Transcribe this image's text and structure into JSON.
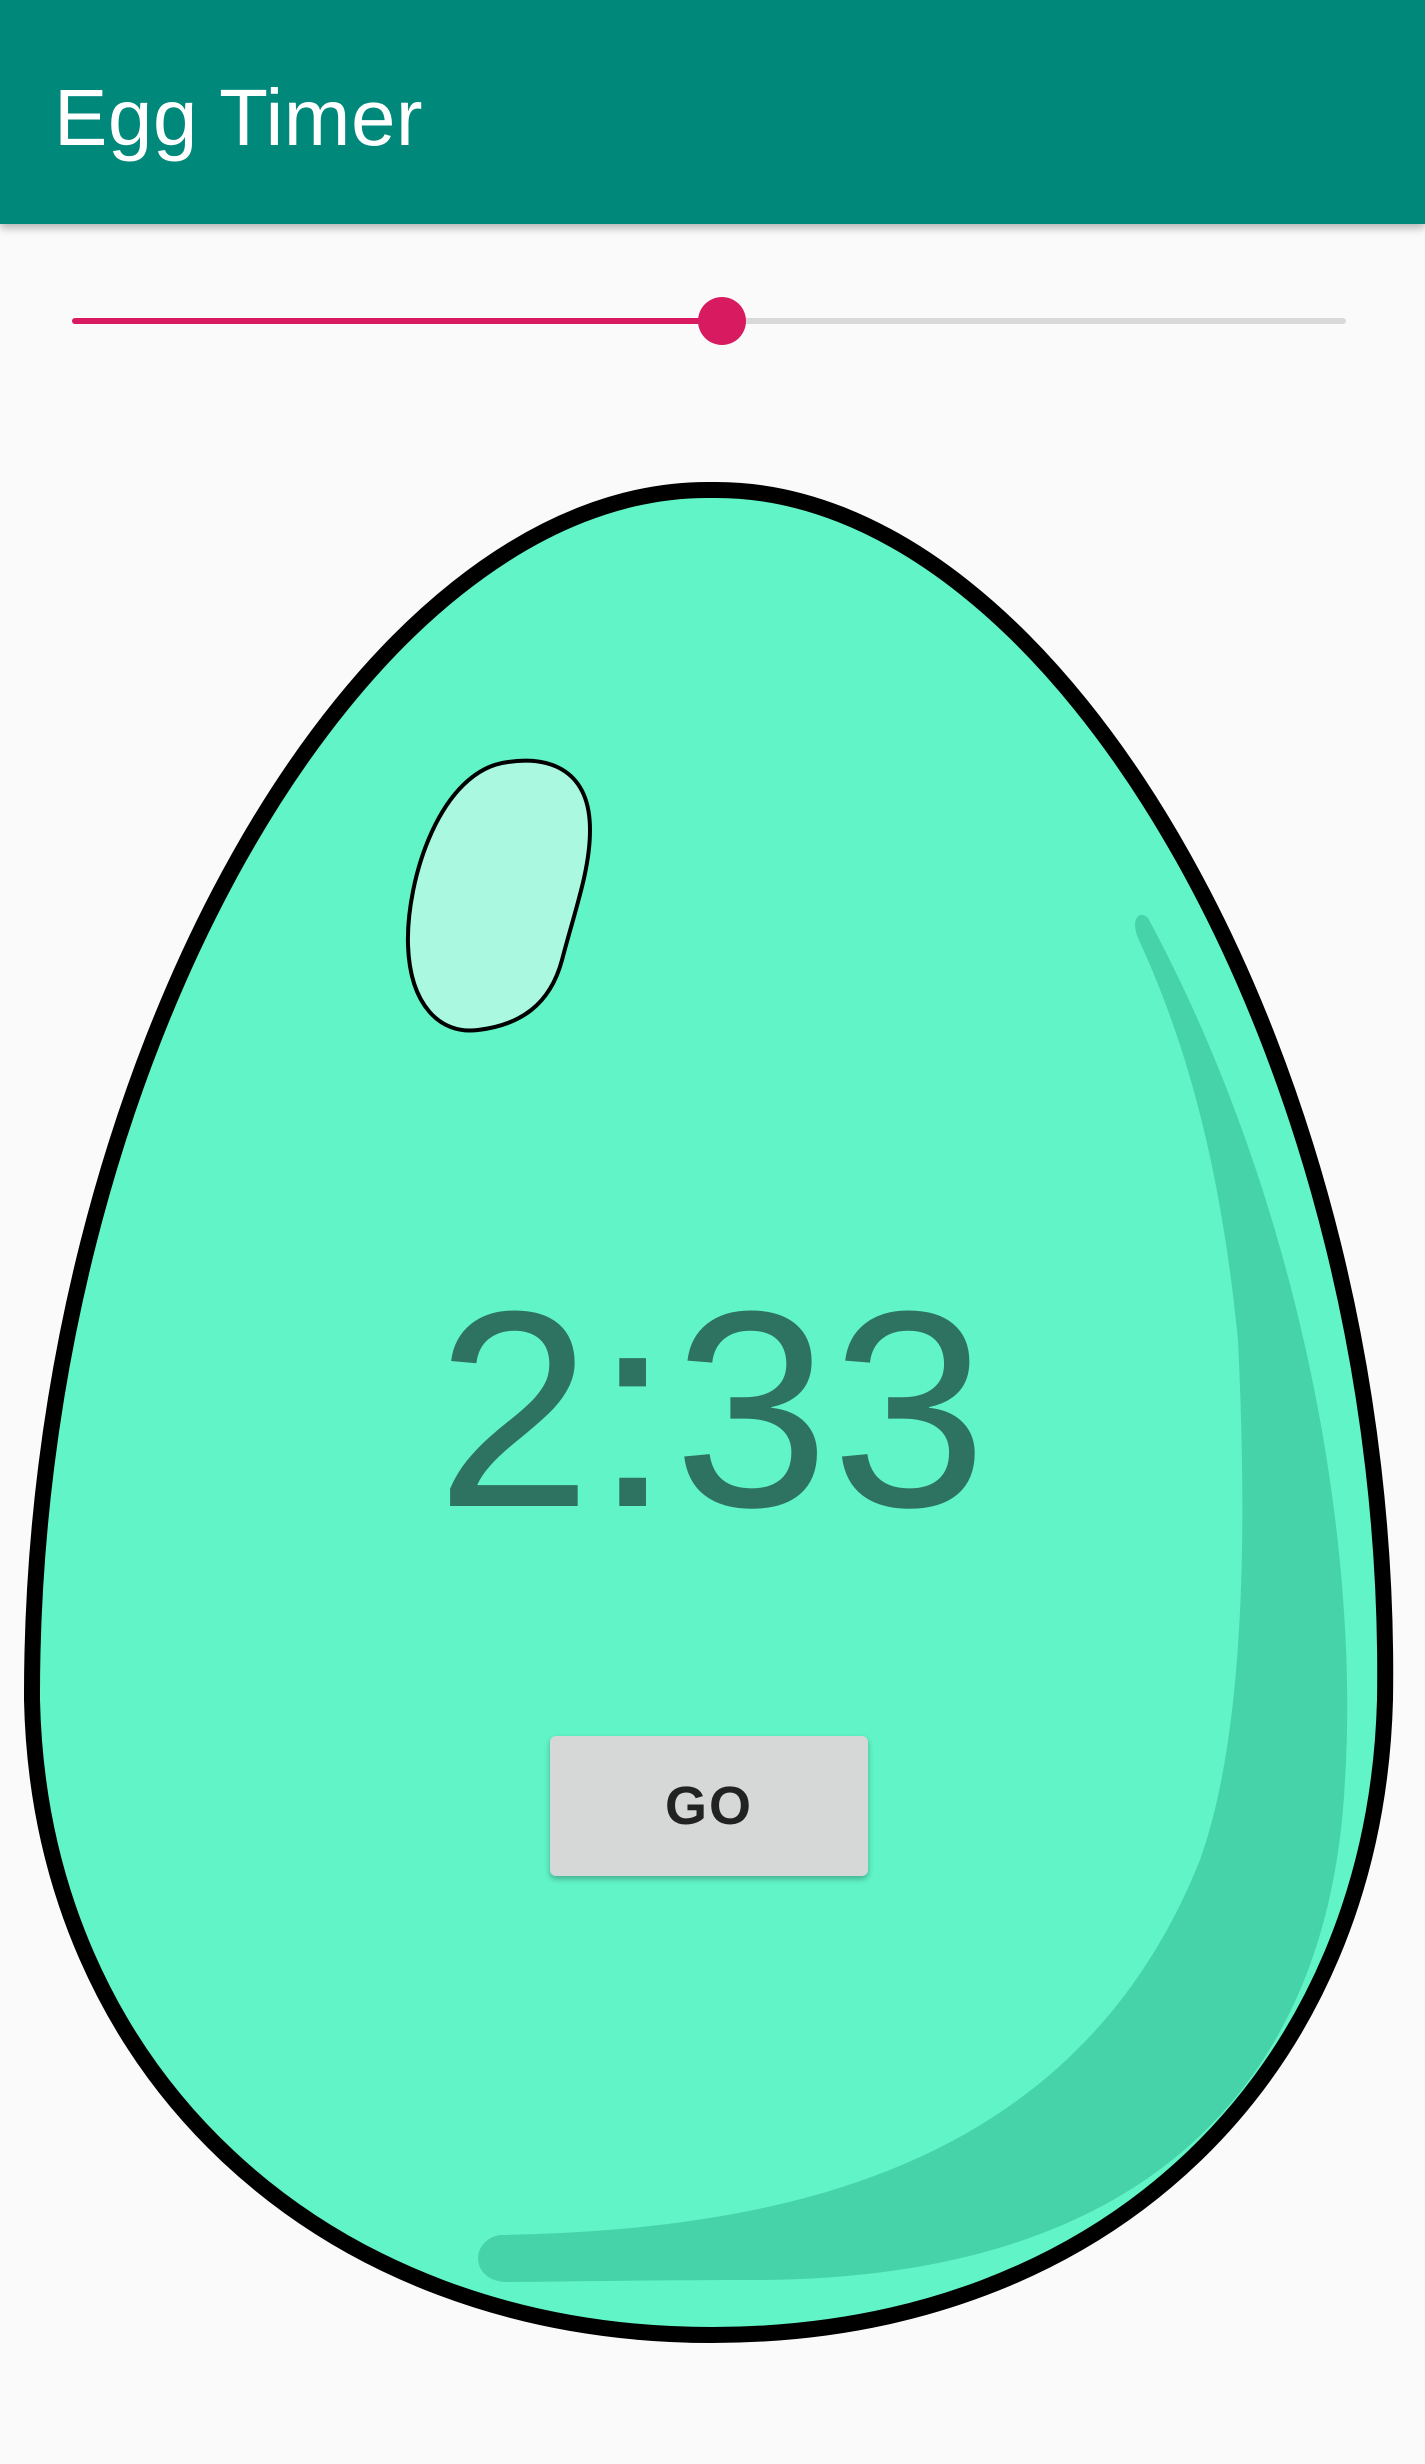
{
  "app_bar": {
    "title": "Egg Timer",
    "color": "#00897b"
  },
  "slider": {
    "value_fraction": 0.51,
    "active_color": "#d81b60",
    "inactive_color": "#d9d9d9"
  },
  "egg": {
    "fill_color": "#60f4c6",
    "shade_color": "#47d3a9",
    "highlight_color": "#aaf8e0",
    "outline_color": "#000000"
  },
  "timer": {
    "display": "2:33"
  },
  "go_button": {
    "label": "GO"
  }
}
